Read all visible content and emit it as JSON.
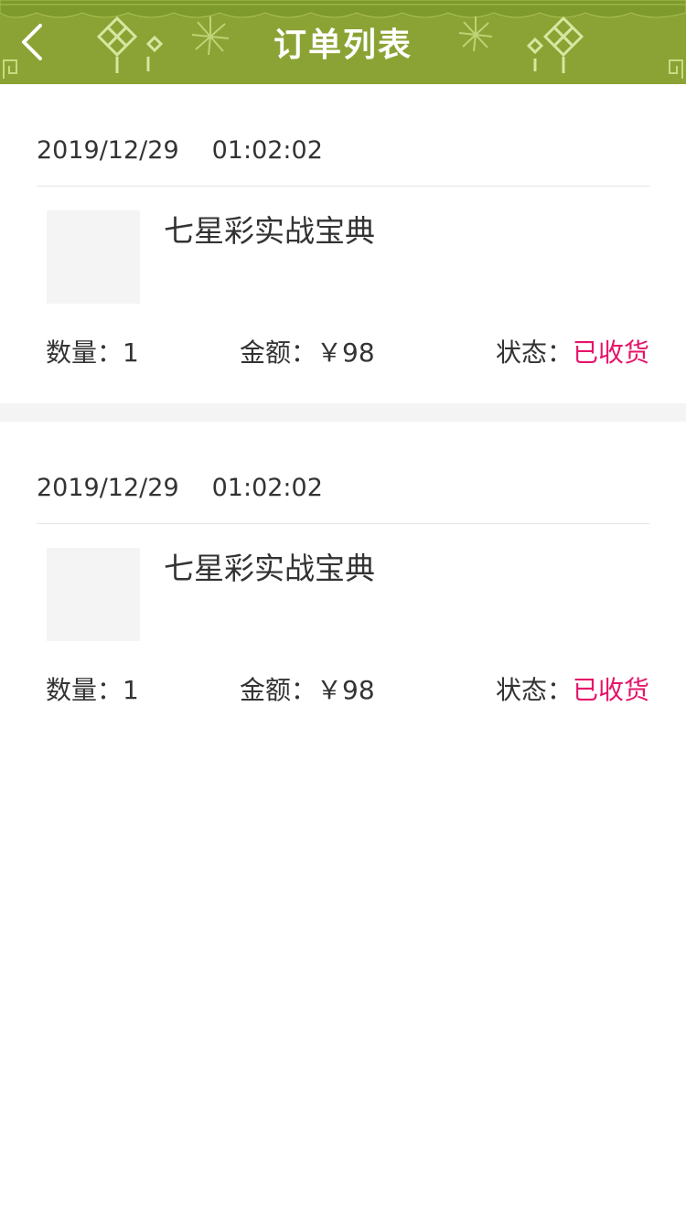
{
  "header": {
    "title": "订单列表",
    "back_icon": "chevron-left-icon",
    "background_color": "#8aa334"
  },
  "orders": [
    {
      "date": "2019/12/29",
      "time": "01:02:02",
      "product_name": "七星彩实战宝典",
      "quantity_label": "数量：",
      "quantity_value": "1",
      "amount_label": "金额：",
      "amount_value": "￥98",
      "status_label": "状态：",
      "status_value": "已收货"
    },
    {
      "date": "2019/12/29",
      "time": "01:02:02",
      "product_name": "七星彩实战宝典",
      "quantity_label": "数量：",
      "quantity_value": "1",
      "amount_label": "金额：",
      "amount_value": "￥98",
      "status_label": "状态：",
      "status_value": "已收货"
    }
  ],
  "colors": {
    "status_accent": "#e5156a",
    "text": "#333333",
    "gap": "#f4f4f4"
  }
}
